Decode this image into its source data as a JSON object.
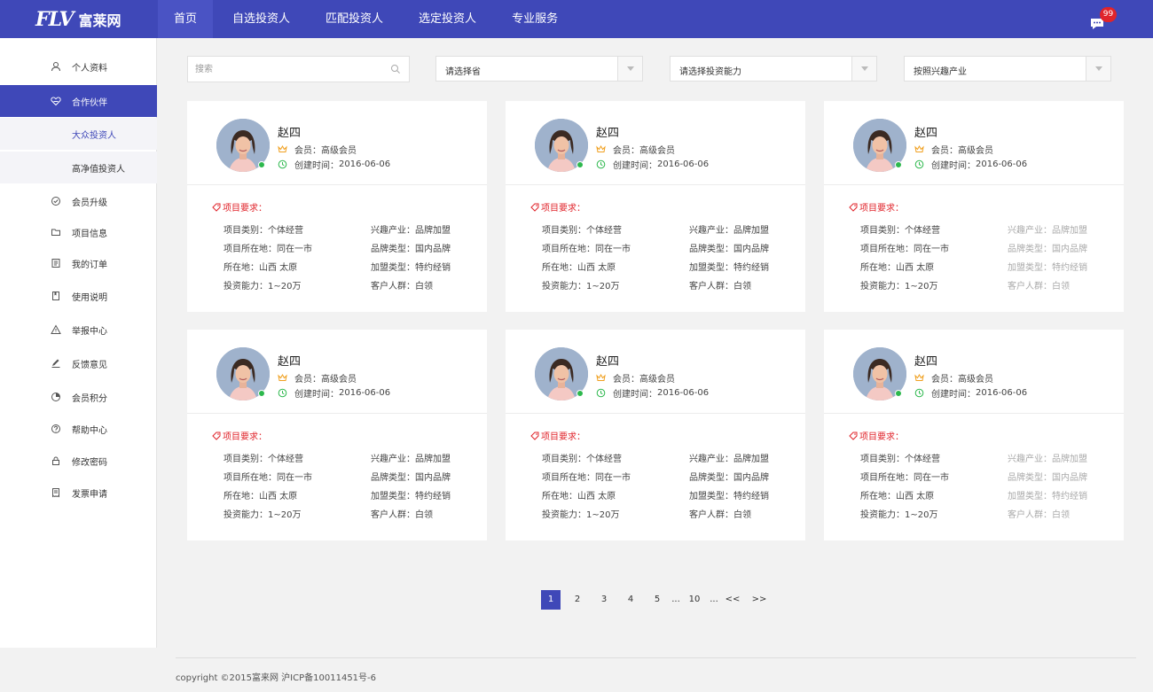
{
  "brand": {
    "mark": "FLV",
    "name": "富莱网"
  },
  "nav": {
    "items": [
      {
        "label": "首页",
        "active": true
      },
      {
        "label": "自选投资人",
        "active": false
      },
      {
        "label": "匹配投资人",
        "active": false
      },
      {
        "label": "选定投资人",
        "active": false
      },
      {
        "label": "专业服务",
        "active": false
      }
    ],
    "message_count": "99"
  },
  "sidebar": {
    "items": [
      {
        "label": "个人资料",
        "icon": "user-icon"
      },
      {
        "label": "合作伙伴",
        "icon": "handshake-icon",
        "active": true
      },
      {
        "label": "大众投资人",
        "sub": true,
        "current": true
      },
      {
        "label": "高净值投资人",
        "sub": true
      },
      {
        "label": "会员升级",
        "icon": "check-circle-icon"
      },
      {
        "label": "项目信息",
        "icon": "folder-icon"
      },
      {
        "label": "我的订单",
        "icon": "order-icon"
      },
      {
        "label": "使用说明",
        "icon": "book-icon"
      },
      {
        "label": "举报中心",
        "icon": "warning-icon"
      },
      {
        "label": "反馈意见",
        "icon": "pen-icon"
      },
      {
        "label": "会员积分",
        "icon": "pie-chart-icon"
      },
      {
        "label": "帮助中心",
        "icon": "help-icon"
      },
      {
        "label": "修改密码",
        "icon": "lock-icon"
      },
      {
        "label": "发票申请",
        "icon": "invoice-icon"
      }
    ]
  },
  "filters": {
    "search_placeholder": "搜索",
    "province": "请选择省",
    "capacity": "请选择投资能力",
    "industry": "按照兴趣产业"
  },
  "card_labels": {
    "member_prefix": "会员：",
    "created_prefix": "创建时间：",
    "requirements": "项目要求："
  },
  "investors": [
    {
      "name": "赵四",
      "member_level": "高级会员",
      "created": "2016-06-06",
      "project_type": "项目类别：个体经营",
      "project_location": "项目所在地：同在一市",
      "location": "所在地：山西  太原",
      "investment": "投资能力：1~20万",
      "industry": "兴趣产业：品牌加盟",
      "brand_type": "品牌类型：国内品牌",
      "franchise_type": "加盟类型：特约经销",
      "customers": "客户人群：白领",
      "muted_right": false
    },
    {
      "name": "赵四",
      "member_level": "高级会员",
      "created": "2016-06-06",
      "project_type": "项目类别：个体经营",
      "project_location": "项目所在地：同在一市",
      "location": "所在地：山西  太原",
      "investment": "投资能力：1~20万",
      "industry": "兴趣产业：品牌加盟",
      "brand_type": "品牌类型：国内品牌",
      "franchise_type": "加盟类型：特约经销",
      "customers": "客户人群：白领",
      "muted_right": false
    },
    {
      "name": "赵四",
      "member_level": "高级会员",
      "created": "2016-06-06",
      "project_type": "项目类别：个体经营",
      "project_location": "项目所在地：同在一市",
      "location": "所在地：山西  太原",
      "investment": "投资能力：1~20万",
      "industry": "兴趣产业：品牌加盟",
      "brand_type": "品牌类型：国内品牌",
      "franchise_type": "加盟类型：特约经销",
      "customers": "客户人群：白领",
      "muted_right": true
    },
    {
      "name": "赵四",
      "member_level": "高级会员",
      "created": "2016-06-06",
      "project_type": "项目类别：个体经营",
      "project_location": "项目所在地：同在一市",
      "location": "所在地：山西  太原",
      "investment": "投资能力：1~20万",
      "industry": "兴趣产业：品牌加盟",
      "brand_type": "品牌类型：国内品牌",
      "franchise_type": "加盟类型：特约经销",
      "customers": "客户人群：白领",
      "muted_right": false
    },
    {
      "name": "赵四",
      "member_level": "高级会员",
      "created": "2016-06-06",
      "project_type": "项目类别：个体经营",
      "project_location": "项目所在地：同在一市",
      "location": "所在地：山西  太原",
      "investment": "投资能力：1~20万",
      "industry": "兴趣产业：品牌加盟",
      "brand_type": "品牌类型：国内品牌",
      "franchise_type": "加盟类型：特约经销",
      "customers": "客户人群：白领",
      "muted_right": false
    },
    {
      "name": "赵四",
      "member_level": "高级会员",
      "created": "2016-06-06",
      "project_type": "项目类别：个体经营",
      "project_location": "项目所在地：同在一市",
      "location": "所在地：山西  太原",
      "investment": "投资能力：1~20万",
      "industry": "兴趣产业：品牌加盟",
      "brand_type": "品牌类型：国内品牌",
      "franchise_type": "加盟类型：特约经销",
      "customers": "客户人群：白领",
      "muted_right": true
    }
  ],
  "pagination": {
    "pages": [
      "1",
      "2",
      "3",
      "4",
      "5",
      "...",
      "10",
      "...",
      "<<",
      ">>"
    ],
    "current": "1"
  },
  "footer": {
    "copyright": "copyright ©2015富来网 沪ICP备10011451号-6"
  },
  "colors": {
    "primary": "#3f48b8",
    "accent_red": "#e0242b",
    "online_green": "#2db84d",
    "crown": "#f0a020"
  }
}
